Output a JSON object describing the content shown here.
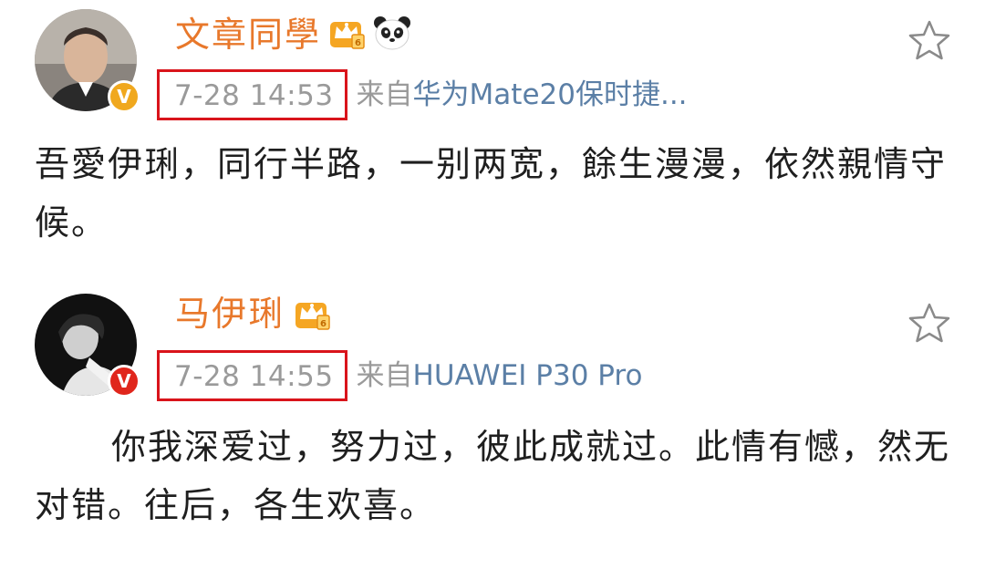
{
  "posts": [
    {
      "username": "文章同學",
      "username_color": "#e8782b",
      "badges": [
        "crown-vip-icon",
        "panda-icon"
      ],
      "avatar_badge_color": "#f0a81e",
      "avatar_badge_glyph": "V",
      "timestamp": "7-28 14:53",
      "source_prefix": "来自",
      "source_device": "华为Mate20保时捷...",
      "content": "吾愛伊琍，同行半路，一别两宽，餘生漫漫，依然親情守候。"
    },
    {
      "username": "马伊琍",
      "username_color": "#e8782b",
      "badges": [
        "crown-vip-icon"
      ],
      "avatar_badge_color": "#e0261c",
      "avatar_badge_glyph": "V",
      "timestamp": "7-28 14:55",
      "source_prefix": "来自",
      "source_device": "HUAWEI P30 Pro",
      "content": "你我深爱过，努力过，彼此成就过。此情有憾，然无对错。往后，各生欢喜。"
    }
  ],
  "colors": {
    "highlight_box": "#d9141b",
    "meta_text": "#9a9a9a",
    "source_link": "#5b7fa6",
    "star_outline": "#8a8a8a"
  }
}
